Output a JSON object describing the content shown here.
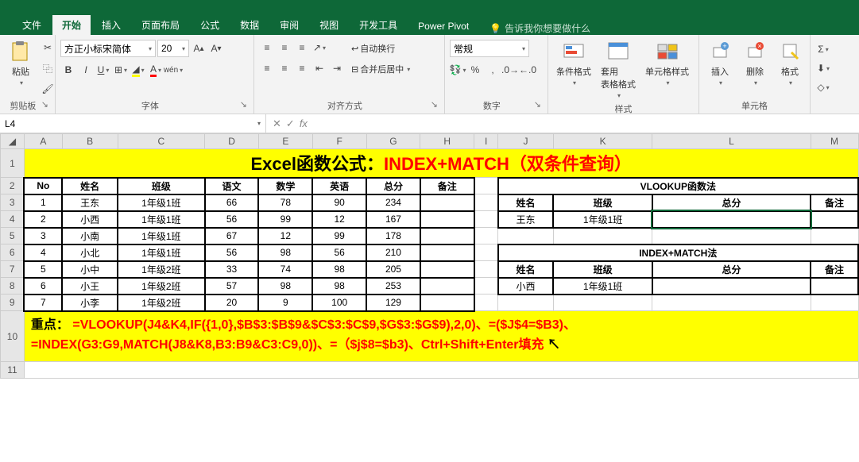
{
  "tabs": [
    "文件",
    "开始",
    "插入",
    "页面布局",
    "公式",
    "数据",
    "审阅",
    "视图",
    "开发工具",
    "Power Pivot"
  ],
  "tell_me": "告诉我你想要做什么",
  "ribbon": {
    "clipboard": {
      "paste": "粘贴",
      "label": "剪贴板"
    },
    "font": {
      "name": "方正小标宋简体",
      "size": "20",
      "label": "字体"
    },
    "align": {
      "wrap": "自动换行",
      "merge": "合并后居中",
      "label": "对齐方式"
    },
    "number": {
      "fmt": "常规",
      "label": "数字"
    },
    "styles": {
      "cond": "条件格式",
      "table": "套用\n表格格式",
      "cell": "单元格样式",
      "label": "样式"
    },
    "cells": {
      "insert": "插入",
      "delete": "删除",
      "format": "格式",
      "label": "单元格"
    }
  },
  "namebox": "L4",
  "sheet": {
    "title": {
      "black": "Excel函数公式：",
      "red": "INDEX+MATCH（双条件查询）"
    },
    "headers": [
      "No",
      "姓名",
      "班级",
      "语文",
      "数学",
      "英语",
      "总分",
      "备注"
    ],
    "rows": [
      [
        "1",
        "王东",
        "1年级1班",
        "66",
        "78",
        "90",
        "234",
        ""
      ],
      [
        "2",
        "小西",
        "1年级1班",
        "56",
        "99",
        "12",
        "167",
        ""
      ],
      [
        "3",
        "小南",
        "1年级1班",
        "67",
        "12",
        "99",
        "178",
        ""
      ],
      [
        "4",
        "小北",
        "1年级1班",
        "56",
        "98",
        "56",
        "210",
        ""
      ],
      [
        "5",
        "小中",
        "1年级2班",
        "33",
        "74",
        "98",
        "205",
        ""
      ],
      [
        "6",
        "小王",
        "1年级2班",
        "57",
        "98",
        "98",
        "253",
        ""
      ],
      [
        "7",
        "小李",
        "1年级2班",
        "20",
        "9",
        "100",
        "129",
        ""
      ]
    ],
    "vlookup": {
      "title": "VLOOKUP函数法",
      "hdr": [
        "姓名",
        "班级",
        "总分",
        "备注"
      ],
      "row": [
        "王东",
        "1年级1班",
        "",
        ""
      ]
    },
    "indexmatch": {
      "title": "INDEX+MATCH法",
      "hdr": [
        "姓名",
        "班级",
        "总分",
        "备注"
      ],
      "row": [
        "小西",
        "1年级1班",
        "",
        ""
      ]
    },
    "formula": {
      "label": "重点：",
      "line1": "=VLOOKUP(J4&K4,IF({1,0},$B$3:$B$9&$C$3:$C$9,$G$3:$G$9),2,0)、=($J$4=$B3)、",
      "line2": "=INDEX(G3:G9,MATCH(J8&K8,B3:B9&C3:C9,0))、=（$j$8=$b3)、Ctrl+Shift+Enter填充"
    }
  },
  "cols": [
    "A",
    "B",
    "C",
    "D",
    "E",
    "F",
    "G",
    "H",
    "I",
    "J",
    "K",
    "L",
    "M"
  ]
}
